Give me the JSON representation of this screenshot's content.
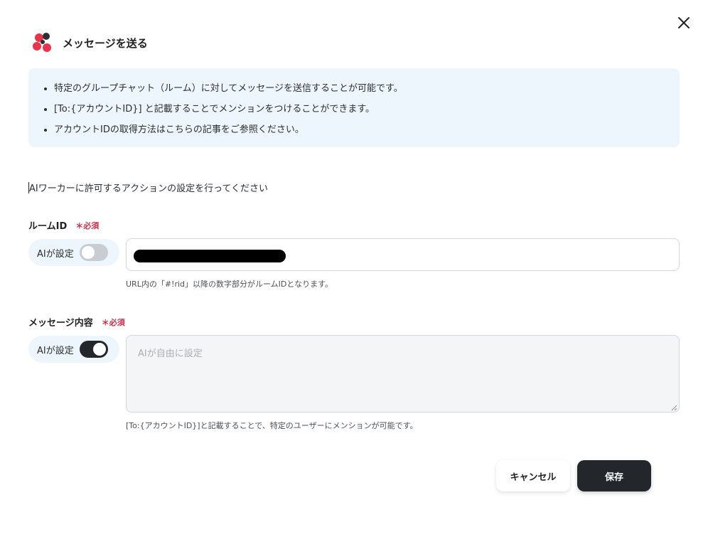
{
  "modal": {
    "title": "メッセージを送る",
    "close_icon": "close-icon",
    "logo_icon": "chatwork-logo",
    "brand_color": "#e8334a"
  },
  "info": {
    "items": [
      "特定のグループチャット（ルーム）に対してメッセージを送信することが可能です。",
      "[To:{アカウントID}] と記載することでメンションをつけることができます。",
      "アカウントIDの取得方法はこちらの記事をご参照ください。"
    ]
  },
  "section": {
    "description": "AIワーカーに許可するアクションの設定を行ってください"
  },
  "room_id": {
    "label": "ルームID",
    "required": "＊必須",
    "ai_label": "AIが設定",
    "ai_enabled": false,
    "value": "",
    "hint": "URL内の「#!rid」以降の数字部分がルームIDとなります。"
  },
  "message": {
    "label": "メッセージ内容",
    "required": "＊必須",
    "ai_label": "AIが設定",
    "ai_enabled": true,
    "placeholder": "AIが自由に設定",
    "hint": "[To:{アカウントID}]と記載することで、特定のユーザーにメンションが可能です。"
  },
  "actions": {
    "cancel_label": "キャンセル",
    "save_label": "保存"
  }
}
